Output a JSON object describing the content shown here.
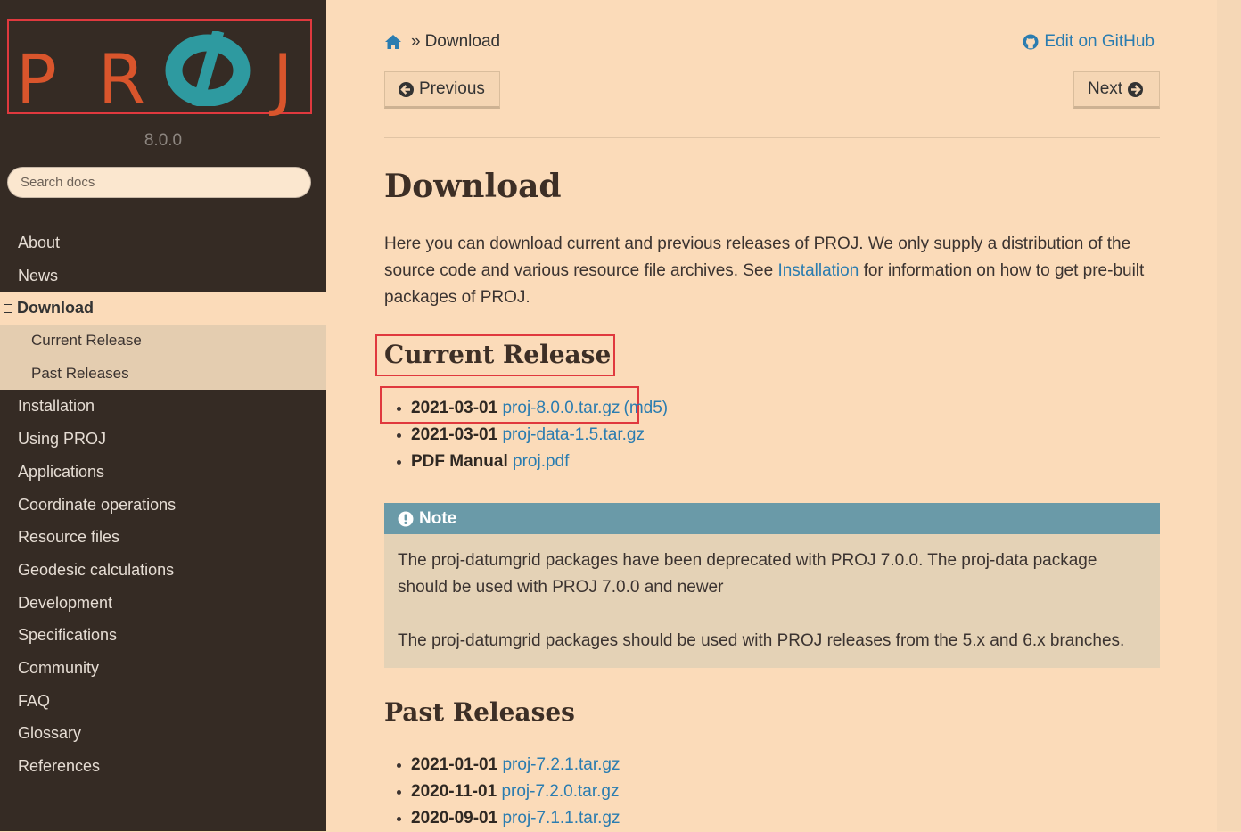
{
  "sidebar": {
    "logo_letters": [
      "P",
      "R",
      "Ø",
      "J"
    ],
    "version": "8.0.0",
    "search_placeholder": "Search docs",
    "items_before": [
      "About",
      "News"
    ],
    "current": "Download",
    "subitems": [
      "Current Release",
      "Past Releases"
    ],
    "items_after": [
      "Installation",
      "Using PROJ",
      "Applications",
      "Coordinate operations",
      "Resource files",
      "Geodesic calculations",
      "Development",
      "Specifications",
      "Community",
      "FAQ",
      "Glossary",
      "References"
    ]
  },
  "breadcrumb": {
    "separator": "»",
    "current": "Download"
  },
  "edit_link": "Edit on GitHub",
  "buttons": {
    "previous": "Previous",
    "next": "Next"
  },
  "page_title": "Download",
  "intro": {
    "before": "Here you can download current and previous releases of PROJ. We only supply a distribution of the source code and various resource file archives. See ",
    "link": "Installation",
    "after": " for information on how to get pre-built packages of PROJ."
  },
  "current_release": {
    "heading": "Current Release",
    "items": [
      {
        "date": "2021-03-01",
        "link": "proj-8.0.0.tar.gz",
        "extra": "(md5)"
      },
      {
        "date": "2021-03-01",
        "link": "proj-data-1.5.tar.gz",
        "extra": ""
      },
      {
        "date": "PDF Manual",
        "link": "proj.pdf",
        "extra": ""
      }
    ]
  },
  "note": {
    "title": "Note",
    "paragraphs": [
      "The proj-datumgrid packages have been deprecated with PROJ 7.0.0. The proj-data package should be used with PROJ 7.0.0 and newer",
      "The proj-datumgrid packages should be used with PROJ releases from the 5.x and 6.x branches."
    ]
  },
  "past_releases": {
    "heading": "Past Releases",
    "items": [
      {
        "date": "2021-01-01",
        "link": "proj-7.2.1.tar.gz"
      },
      {
        "date": "2020-11-01",
        "link": "proj-7.2.0.tar.gz"
      },
      {
        "date": "2020-09-01",
        "link": "proj-7.1.1.tar.gz"
      }
    ]
  },
  "colors": {
    "link": "#2a7cb0",
    "sidebar_bg": "#352b24",
    "page_bg": "#fbdbb9",
    "note_header": "#6a9aa8",
    "highlight_box": "#e0393e"
  }
}
